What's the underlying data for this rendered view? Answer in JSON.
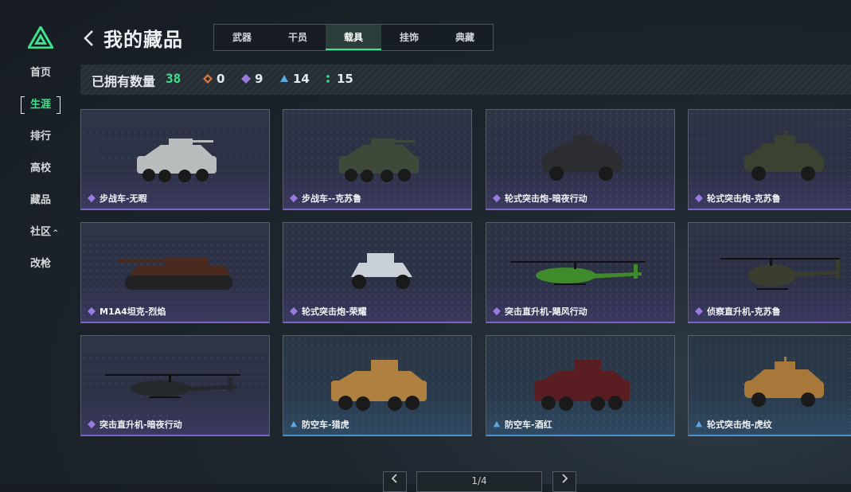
{
  "sidebar": {
    "items": [
      {
        "label": "首页"
      },
      {
        "label": "生涯"
      },
      {
        "label": "排行"
      },
      {
        "label": "高校"
      },
      {
        "label": "藏品"
      },
      {
        "label": "社区"
      },
      {
        "label": "改枪"
      }
    ],
    "community_chevron": "^"
  },
  "header": {
    "title": "我的藏品",
    "back_icon": "chevron-left-icon",
    "tabs": [
      {
        "label": "武器"
      },
      {
        "label": "干员"
      },
      {
        "label": "载具"
      },
      {
        "label": "挂饰"
      },
      {
        "label": "典藏"
      }
    ],
    "active_tab": "载具"
  },
  "stats": {
    "owned_label": "已拥有数量",
    "owned_total": "38",
    "counts": [
      {
        "icon": "orange-diamond-icon",
        "value": "0",
        "color": "#e07a3c"
      },
      {
        "icon": "purple-diamond-icon",
        "value": "9",
        "color": "#9a7ae0"
      },
      {
        "icon": "blue-triangle-icon",
        "value": "14",
        "color": "#5aa6e0"
      },
      {
        "icon": "green-dots-icon",
        "value": "15",
        "color": "#3de38a"
      }
    ]
  },
  "cards": [
    {
      "name": "步战车-无暇",
      "rarity": "purple",
      "vehicle": "ifv-wheeled"
    },
    {
      "name": "步战车--克苏鲁",
      "rarity": "purple",
      "vehicle": "ifv-wheeled"
    },
    {
      "name": "轮式突击炮-暗夜行动",
      "rarity": "purple",
      "vehicle": "assault-gun"
    },
    {
      "name": "轮式突击炮-克苏鲁",
      "rarity": "purple",
      "vehicle": "assault-gun"
    },
    {
      "name": "M1A4坦克-烈焰",
      "rarity": "purple",
      "vehicle": "tank"
    },
    {
      "name": "轮式突击炮-荣耀",
      "rarity": "purple",
      "vehicle": "buggy"
    },
    {
      "name": "突击直升机-飓风行动",
      "rarity": "purple",
      "vehicle": "attack-helicopter"
    },
    {
      "name": "侦察直升机-克苏鲁",
      "rarity": "purple",
      "vehicle": "scout-helicopter"
    },
    {
      "name": "突击直升机-暗夜行动",
      "rarity": "purple",
      "vehicle": "attack-helicopter"
    },
    {
      "name": "防空车-猎虎",
      "rarity": "blue",
      "vehicle": "aa-vehicle"
    },
    {
      "name": "防空车-酒红",
      "rarity": "blue",
      "vehicle": "aa-vehicle"
    },
    {
      "name": "轮式突击炮-虎纹",
      "rarity": "blue",
      "vehicle": "assault-gun"
    }
  ],
  "pagination": {
    "indicator": "1/4",
    "prev_icon": "chevron-left-icon",
    "next_icon": "chevron-right-icon"
  },
  "colors": {
    "accent": "#3de38a",
    "purple_rarity": "#7b63c4",
    "blue_rarity": "#4d8fc7"
  }
}
